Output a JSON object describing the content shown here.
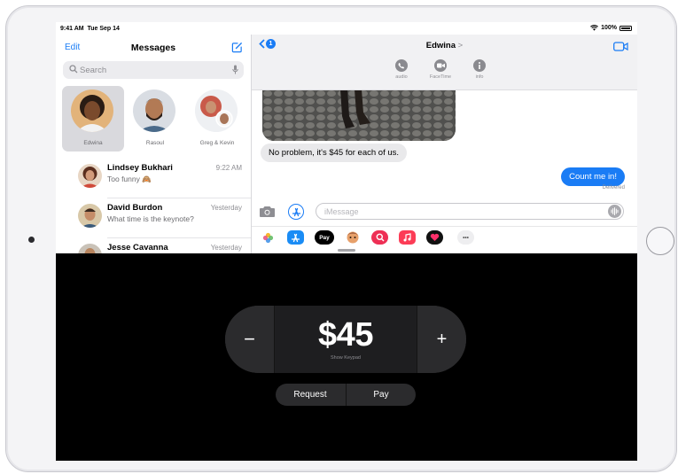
{
  "status_bar": {
    "time": "9:41 AM",
    "date": "Tue Sep 14",
    "battery": "100%"
  },
  "sidebar": {
    "edit_label": "Edit",
    "title": "Messages",
    "search_placeholder": "Search",
    "pinned": [
      {
        "name": "Edwina",
        "selected": true
      },
      {
        "name": "Rasoul",
        "selected": false
      },
      {
        "name": "Greg & Kevin",
        "selected": false
      }
    ],
    "conversations": [
      {
        "name": "Lindsey Bukhari",
        "time": "9:22 AM",
        "preview": "Too funny 🙈"
      },
      {
        "name": "David Burdon",
        "time": "Yesterday",
        "preview": "What time is the keynote?"
      },
      {
        "name": "Jesse Cavanna",
        "time": "Yesterday",
        "preview": ""
      }
    ]
  },
  "conversation": {
    "contact_name": "Edwina",
    "contact_chevron": ">",
    "back_badge": "1",
    "actions": [
      {
        "label": "audio",
        "icon": "phone-icon"
      },
      {
        "label": "FaceTime",
        "icon": "video-icon"
      },
      {
        "label": "info",
        "icon": "info-icon"
      }
    ],
    "incoming_message": "No problem, it's $45 for each of us.",
    "outgoing_message": "Count me in!",
    "delivery_status": "Delivered",
    "input_placeholder": "iMessage",
    "app_drawer": [
      "photos-app-icon",
      "app-store-icon",
      "apple-pay-icon",
      "memoji-icon",
      "search-images-icon",
      "music-icon",
      "digital-touch-icon",
      "more-icon"
    ],
    "apple_pay_label": "Pay",
    "more_label": "•••"
  },
  "apple_pay": {
    "minus_label": "−",
    "amount": "$45",
    "show_keypad_label": "Show Keypad",
    "plus_label": "+",
    "request_label": "Request",
    "pay_label": "Pay"
  },
  "colors": {
    "accent": "#1a7cf5",
    "bubble_incoming": "#e9e9eb",
    "panel_bg": "#000000",
    "control_bg": "#2b2b2d"
  }
}
